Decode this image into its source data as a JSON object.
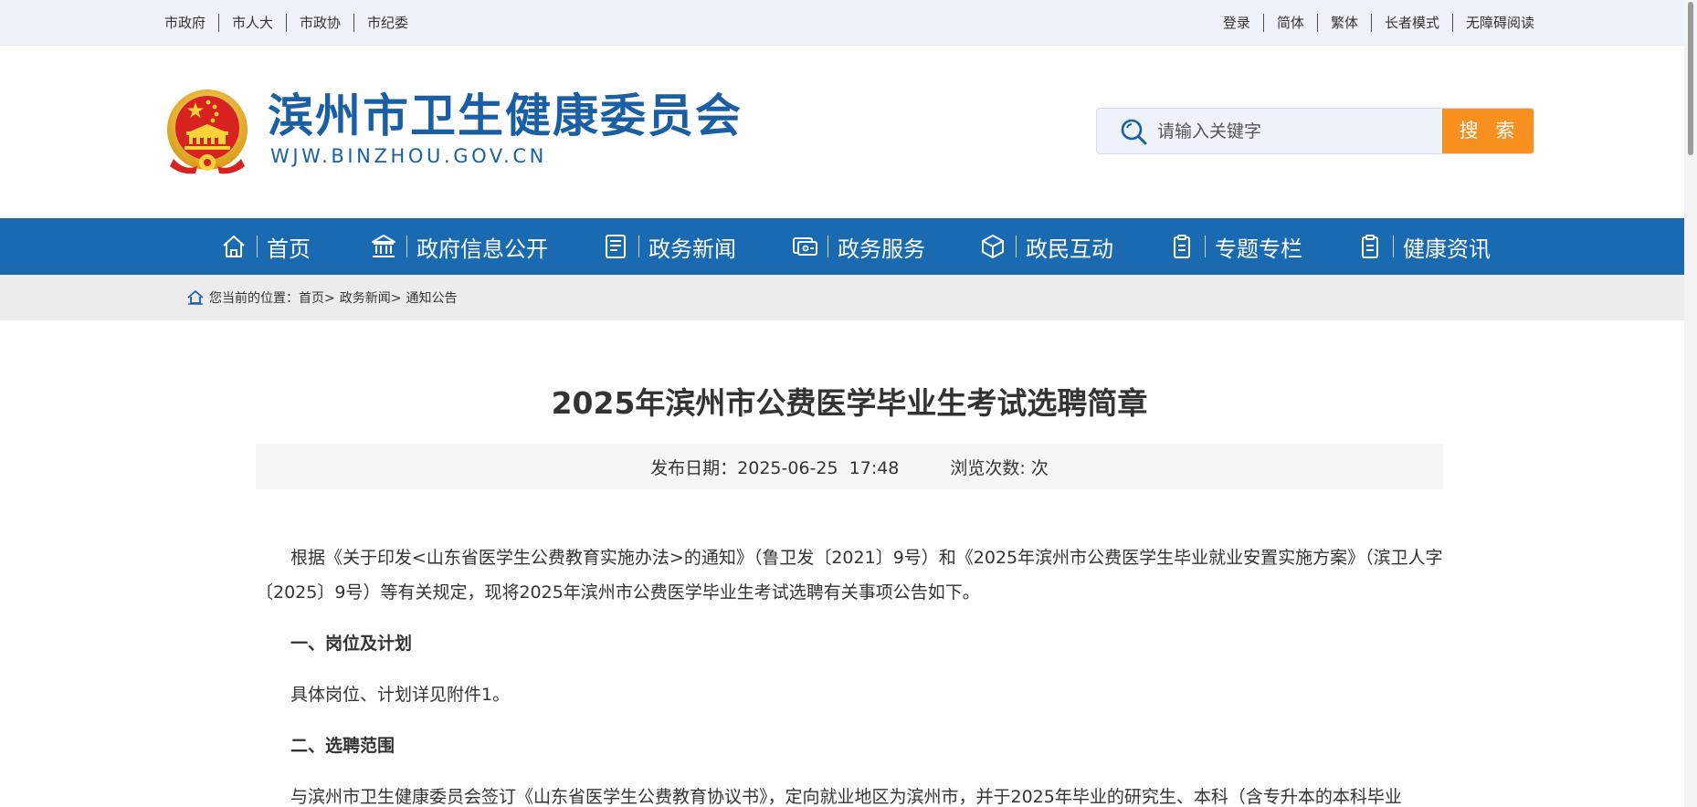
{
  "topbar": {
    "left_links": [
      "市政府",
      "市人大",
      "市政协",
      "市纪委"
    ],
    "right_links": [
      "登录",
      "简体",
      "繁体",
      "长者模式",
      "无障碍阅读"
    ]
  },
  "header": {
    "site_title": "滨州市卫生健康委员会",
    "site_domain": "WJW.BINZHOU.GOV.CN",
    "search_placeholder": "请输入关键字",
    "search_button": "搜 索"
  },
  "nav": {
    "items": [
      {
        "label": "首页",
        "icon": "home-icon"
      },
      {
        "label": "政府信息公开",
        "icon": "government-building-icon"
      },
      {
        "label": "政务新闻",
        "icon": "news-document-icon"
      },
      {
        "label": "政务服务",
        "icon": "service-card-icon"
      },
      {
        "label": "政民互动",
        "icon": "interaction-box-icon"
      },
      {
        "label": "专题专栏",
        "icon": "column-clipboard-icon"
      },
      {
        "label": "健康资讯",
        "icon": "health-clipboard-icon"
      }
    ]
  },
  "breadcrumb": {
    "prefix": "您当前的位置：",
    "items": [
      "首页>",
      "政务新闻>",
      "通知公告"
    ]
  },
  "article": {
    "title": "2025年滨州市公费医学毕业生考试选聘简章",
    "publish_label": "发布日期：2025-06-25  17:48",
    "views_label": "浏览次数: 次",
    "para1": "根据《关于印发<山东省医学生公费教育实施办法>的通知》（鲁卫发〔2021〕9号）和《2025年滨州市公费医学生毕业就业安置实施方案》（滨卫人字〔2025〕9号）等有关规定，现将2025年滨州市公费医学毕业生考试选聘有关事项公告如下。",
    "heading1": "一、岗位及计划",
    "para2": "具体岗位、计划详见附件1。",
    "heading2": "二、选聘范围",
    "para3": "与滨州市卫生健康委员会签订《山东省医学生公费教育协议书》，定向就业地区为滨州市，并于2025年毕业的研究生、本科（含专升本的本科毕业"
  },
  "colors": {
    "nav_blue": "#1a6ab2",
    "title_blue": "#1a5fa3",
    "search_orange": "#f7901e",
    "topbar_bg": "#edf2fb"
  }
}
